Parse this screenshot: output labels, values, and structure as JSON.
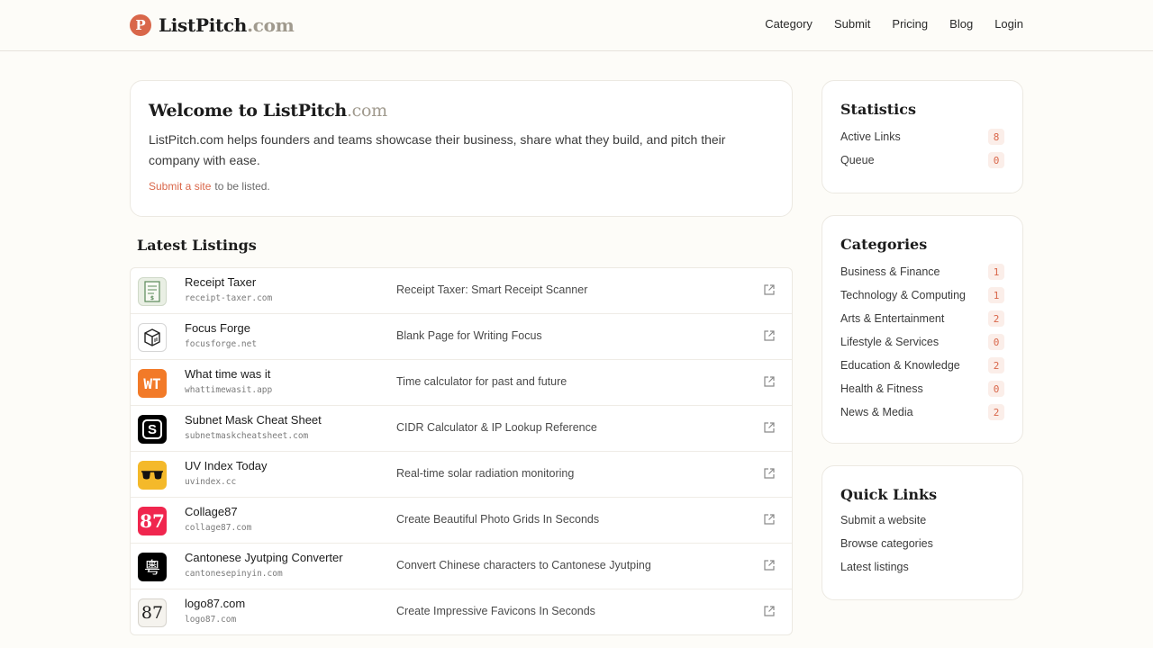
{
  "brand": {
    "logo_letter": "P",
    "name": "ListPitch",
    "tld": ".com",
    "accent": "#d9674a"
  },
  "nav": [
    "Category",
    "Submit",
    "Pricing",
    "Blog",
    "Login"
  ],
  "welcome": {
    "title_main": "Welcome to ListPitch",
    "title_tld": ".com",
    "description": "ListPitch.com helps founders and teams showcase their business, share what they build, and pitch their company with ease.",
    "submit_link": "Submit a site",
    "submit_suffix": "to be listed."
  },
  "latest": {
    "title": "Latest Listings",
    "items": [
      {
        "name": "Receipt Taxer",
        "domain": "receipt-taxer.com",
        "tagline": "Receipt Taxer: Smart Receipt Scanner",
        "icon": "receipt-icon"
      },
      {
        "name": "Focus Forge",
        "domain": "focusforge.net",
        "tagline": "Blank Page for Writing Focus",
        "icon": "cube-icon"
      },
      {
        "name": "What time was it",
        "domain": "whattimewasit.app",
        "tagline": "Time calculator for past and future",
        "icon": "wt-logo-icon",
        "icon_text": "WT"
      },
      {
        "name": "Subnet Mask Cheat Sheet",
        "domain": "subnetmaskcheatsheet.com",
        "tagline": "CIDR Calculator & IP Lookup Reference",
        "icon": "s-logo-icon",
        "icon_text": "S"
      },
      {
        "name": "UV Index Today",
        "domain": "uvindex.cc",
        "tagline": "Real-time solar radiation monitoring",
        "icon": "sunglasses-icon"
      },
      {
        "name": "Collage87",
        "domain": "collage87.com",
        "tagline": "Create Beautiful Photo Grids In Seconds",
        "icon": "collage87-logo-icon",
        "icon_text": "87"
      },
      {
        "name": "Cantonese Jyutping Converter",
        "domain": "cantonesepinyin.com",
        "tagline": "Convert Chinese characters to Cantonese Jyutping",
        "icon": "yue-character-icon",
        "icon_text": "粵"
      },
      {
        "name": "logo87.com",
        "domain": "logo87.com",
        "tagline": "Create Impressive Favicons In Seconds",
        "icon": "logo87-icon",
        "icon_text": "87"
      }
    ]
  },
  "statistics": {
    "title": "Statistics",
    "items": [
      {
        "label": "Active Links",
        "value": "8"
      },
      {
        "label": "Queue",
        "value": "0"
      }
    ]
  },
  "categories": {
    "title": "Categories",
    "items": [
      {
        "label": "Business & Finance",
        "count": "1"
      },
      {
        "label": "Technology & Computing",
        "count": "1"
      },
      {
        "label": "Arts & Entertainment",
        "count": "2"
      },
      {
        "label": "Lifestyle & Services",
        "count": "0"
      },
      {
        "label": "Education & Knowledge",
        "count": "2"
      },
      {
        "label": "Health & Fitness",
        "count": "0"
      },
      {
        "label": "News & Media",
        "count": "2"
      }
    ]
  },
  "quick_links": {
    "title": "Quick Links",
    "items": [
      "Submit a website",
      "Browse categories",
      "Latest listings"
    ]
  }
}
